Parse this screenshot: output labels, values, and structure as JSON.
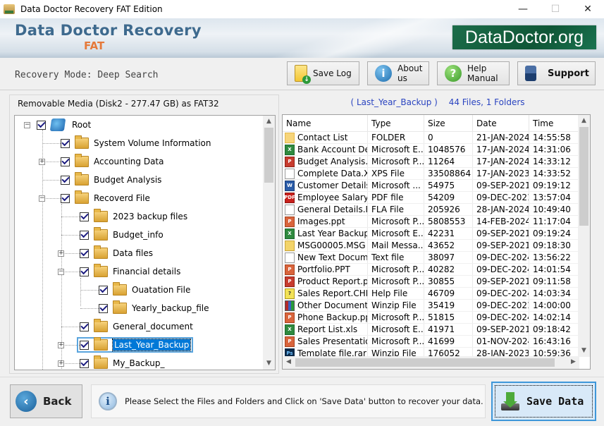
{
  "window": {
    "title": "Data Doctor Recovery FAT Edition",
    "minimize": "—",
    "maximize": "☐",
    "close": "✕"
  },
  "banner": {
    "brand": "Data Doctor Recovery",
    "edition": "FAT",
    "logo": "DataDoctor.org"
  },
  "toolbar": {
    "mode": "Recovery Mode: Deep Search",
    "save_log": "Save Log",
    "about_us": "About us",
    "help_manual": "Help Manual",
    "support": "Support"
  },
  "tree": {
    "drive_label": "Removable Media (Disk2 - 277.47 GB) as FAT32",
    "nodes": [
      {
        "label": "Root",
        "level": 0,
        "expander": "-",
        "checked": true
      },
      {
        "label": "System Volume Information",
        "level": 1,
        "expander": "",
        "checked": true
      },
      {
        "label": "Accounting Data",
        "level": 1,
        "expander": "+",
        "checked": true
      },
      {
        "label": "Budget Analysis",
        "level": 1,
        "expander": "",
        "checked": true
      },
      {
        "label": "Recoverd File",
        "level": 1,
        "expander": "-",
        "checked": true
      },
      {
        "label": "2023 backup files",
        "level": 2,
        "expander": "",
        "checked": true
      },
      {
        "label": "Budget_info",
        "level": 2,
        "expander": "",
        "checked": true
      },
      {
        "label": "Data files",
        "level": 2,
        "expander": "+",
        "checked": true
      },
      {
        "label": "Financial details",
        "level": 2,
        "expander": "-",
        "checked": true
      },
      {
        "label": "Ouatation File",
        "level": 3,
        "expander": "",
        "checked": true
      },
      {
        "label": "Yearly_backup_file",
        "level": 3,
        "expander": "",
        "checked": true
      },
      {
        "label": "General_document",
        "level": 2,
        "expander": "",
        "checked": true
      },
      {
        "label": "Last_Year_Backup",
        "level": 2,
        "expander": "+",
        "checked": true,
        "selected": true
      },
      {
        "label": "My_Backup_",
        "level": 2,
        "expander": "+",
        "checked": true
      }
    ]
  },
  "list": {
    "folder": "( Last_Year_Backup )",
    "counts": "44 Files, 1 Folders",
    "columns": [
      "Name",
      "Type",
      "Size",
      "Date",
      "Time"
    ],
    "rows": [
      {
        "icon": "folder",
        "name": "Contact List",
        "type": "FOLDER",
        "size": "0",
        "date": "21-JAN-2024",
        "time": "14:55:58"
      },
      {
        "icon": "excel",
        "name": "Bank Account De...",
        "type": "Microsoft E...",
        "size": "1048576",
        "date": "17-JAN-2024",
        "time": "14:31:06"
      },
      {
        "icon": "pps",
        "name": "Budget Analysis....",
        "type": "Microsoft P...",
        "size": "11264",
        "date": "17-JAN-2024",
        "time": "14:33:12"
      },
      {
        "icon": "doc",
        "name": "Complete Data.XPS",
        "type": "XPS File",
        "size": "33508864",
        "date": "17-JAN-2023",
        "time": "14:33:52"
      },
      {
        "icon": "word",
        "name": "Customer Details...",
        "type": "Microsoft ...",
        "size": "54975",
        "date": "09-SEP-2021",
        "time": "09:19:12"
      },
      {
        "icon": "pdf",
        "name": "Employee Salary ...",
        "type": "PDF file",
        "size": "54209",
        "date": "09-DEC-2021",
        "time": "13:57:04"
      },
      {
        "icon": "doc",
        "name": "General Details.FLA",
        "type": "FLA File",
        "size": "205926",
        "date": "28-JAN-2024",
        "time": "10:49:40"
      },
      {
        "icon": "ppt",
        "name": "Images.ppt",
        "type": "Microsoft P...",
        "size": "5808553",
        "date": "14-FEB-2024",
        "time": "11:17:04"
      },
      {
        "icon": "excel",
        "name": "Last Year Backup...",
        "type": "Microsoft E...",
        "size": "42231",
        "date": "09-SEP-2021",
        "time": "09:19:24"
      },
      {
        "icon": "mail",
        "name": "MSG00005.MSG",
        "type": "Mail Messa...",
        "size": "43652",
        "date": "09-SEP-2021",
        "time": "09:18:30"
      },
      {
        "icon": "doc",
        "name": "New Text Docum...",
        "type": "Text file",
        "size": "38097",
        "date": "09-DEC-2024",
        "time": "13:56:22"
      },
      {
        "icon": "ppt",
        "name": "Portfolio.PPT",
        "type": "Microsoft P...",
        "size": "40282",
        "date": "09-DEC-2024",
        "time": "14:01:54"
      },
      {
        "icon": "pps",
        "name": "Product Report.pps",
        "type": "Microsoft P...",
        "size": "30855",
        "date": "09-SEP-2021",
        "time": "09:11:58"
      },
      {
        "icon": "help",
        "name": "Sales Report.CHM",
        "type": "Help File",
        "size": "46709",
        "date": "09-DEC-2024",
        "time": "14:03:34"
      },
      {
        "icon": "zip",
        "name": "Other Document.zip",
        "type": "Winzip File",
        "size": "35419",
        "date": "09-DEC-2021",
        "time": "14:00:00"
      },
      {
        "icon": "ppt",
        "name": "Phone Backup.ppt",
        "type": "Microsoft P...",
        "size": "51815",
        "date": "09-DEC-2024",
        "time": "14:02:14"
      },
      {
        "icon": "excel",
        "name": "Report List.xls",
        "type": "Microsoft E...",
        "size": "41971",
        "date": "09-SEP-2021",
        "time": "09:18:42"
      },
      {
        "icon": "ppt",
        "name": "Sales Presentatio...",
        "type": "Microsoft P...",
        "size": "41699",
        "date": "01-NOV-2024",
        "time": "16:43:16"
      },
      {
        "icon": "ps",
        "name": "Template file.rar",
        "type": "Winzip File",
        "size": "176052",
        "date": "28-JAN-2023",
        "time": "10:59:36"
      }
    ]
  },
  "footer": {
    "back": "Back",
    "message": "Please Select the Files and Folders and Click on 'Save Data' button to recover your data.",
    "save_data": "Save Data"
  },
  "icon_glyphs": {
    "excel": "X",
    "word": "W",
    "pdf": "PDF",
    "ppt": "P",
    "pps": "P",
    "ps": "Ps",
    "help": "?",
    "folder": "",
    "doc": "",
    "mail": "",
    "zip": ""
  }
}
